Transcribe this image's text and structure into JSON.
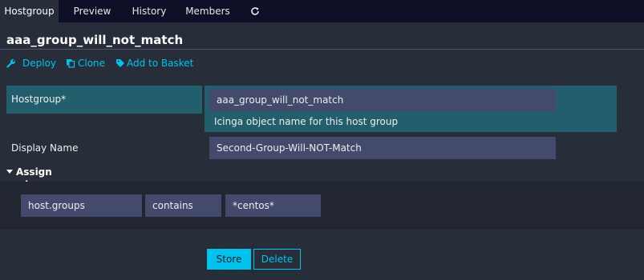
{
  "tabs": [
    {
      "label": "Hostgroup",
      "active": true
    },
    {
      "label": "Preview",
      "active": false
    },
    {
      "label": "History",
      "active": false
    },
    {
      "label": "Members",
      "active": false
    }
  ],
  "refresh_icon": "refresh-icon",
  "page_title": "aaa_group_will_not_match",
  "actions": {
    "deploy": {
      "label": "Deploy",
      "icon": "wrench-icon"
    },
    "clone": {
      "label": "Clone",
      "icon": "copy-icon"
    },
    "basket": {
      "label": "Add to Basket",
      "icon": "tag-icon"
    }
  },
  "form": {
    "hostgroup": {
      "label": "Hostgroup*",
      "value": "aaa_group_will_not_match",
      "hint": "Icinga object name for this host group"
    },
    "display_name": {
      "label": "Display Name",
      "value": "Second-Group-Will-NOT-Match"
    }
  },
  "assign": {
    "section_label": "Assign where",
    "expanded": true,
    "rule": {
      "column": "host.groups",
      "operator": "contains",
      "value": "*centos*"
    }
  },
  "buttons": {
    "store": "Store",
    "delete": "Delete"
  },
  "colors": {
    "accent": "#00c3ed",
    "background": "#282e39",
    "tabbar": "#0e0e26",
    "highlight_panel": "#225e6c",
    "input_bg": "#434a6c"
  }
}
